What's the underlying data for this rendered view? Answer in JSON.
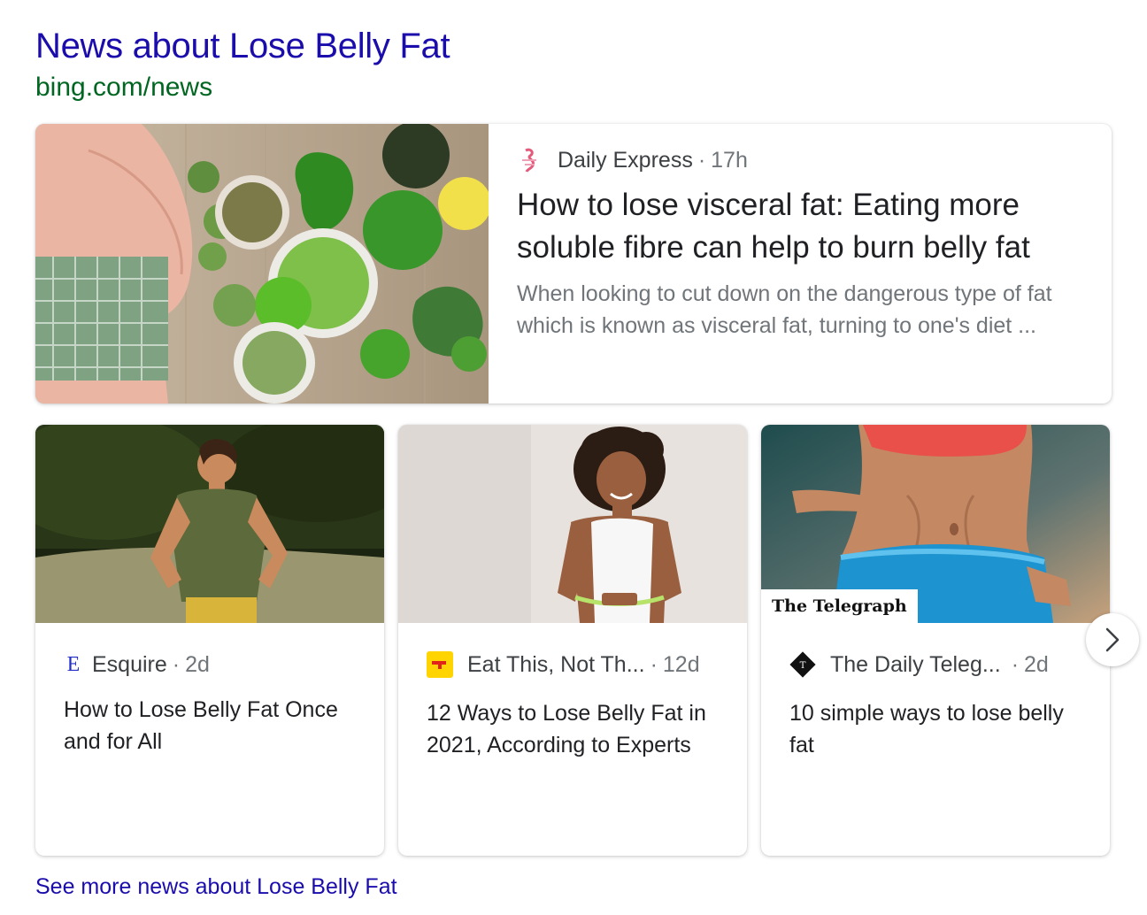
{
  "header": {
    "title": "News about Lose Belly Fat",
    "url": "bing.com/news"
  },
  "featured": {
    "source": "Daily Express",
    "separator": "·",
    "time": "17h",
    "title": "How to lose visceral fat: Eating more soluble fibre can help to burn belly fat",
    "snippet": "When looking to cut down on the dangerous type of fat which is known as visceral fat, turning to one's diet ...",
    "logo_icon": "daily-express-logo-icon",
    "image_icon": "belly-and-vegetables-photo"
  },
  "cards": [
    {
      "logo_text": "E",
      "source": "Esquire",
      "separator": "·",
      "time": "2d",
      "title": "How to Lose Belly Fat Once and for All",
      "logo_icon": "esquire-logo-icon",
      "image_icon": "man-running-photo"
    },
    {
      "source": "Eat This, Not Th...",
      "separator": "·",
      "time": "12d",
      "title": "12 Ways to Lose Belly Fat in 2021, According to Experts",
      "logo_icon": "eat-this-logo-icon",
      "image_icon": "woman-measuring-waist-photo"
    },
    {
      "source": "The Daily Teleg...",
      "separator": "·",
      "time": "2d",
      "title": "10 simple ways to lose belly fat",
      "badge": "The Telegraph",
      "logo_icon": "telegraph-logo-icon",
      "image_icon": "toned-abs-photo"
    }
  ],
  "next_button": {
    "icon": "chevron-right-icon"
  },
  "see_more": "See more news about Lose Belly Fat",
  "colors": {
    "link": "#1a0dab",
    "url_green": "#006621",
    "text": "#202124",
    "muted": "#70757a"
  }
}
